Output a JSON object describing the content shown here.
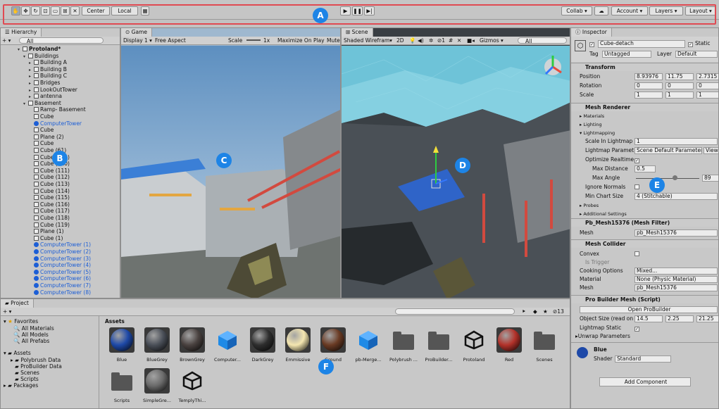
{
  "toolbar": {
    "center": "Center",
    "local": "Local",
    "collab": "Collab ▾",
    "account": "Account ▾",
    "layers": "Layers ▾",
    "layout": "Layout ▾"
  },
  "badges": [
    "A",
    "B",
    "C",
    "D",
    "E",
    "F"
  ],
  "hierarchy": {
    "tab": "Hierarchy",
    "create": "+ ▾",
    "search": "All",
    "items": [
      {
        "t": "Protoland*",
        "k": "scene"
      },
      {
        "t": "Buildings",
        "k": "open"
      },
      {
        "t": "Building A",
        "k": "closed"
      },
      {
        "t": "Building B",
        "k": "closed"
      },
      {
        "t": "Building C",
        "k": "closed"
      },
      {
        "t": "Bridges",
        "k": "closed"
      },
      {
        "t": "LookOutTower",
        "k": "closed"
      },
      {
        "t": "antenna",
        "k": "closed"
      },
      {
        "t": "Basement",
        "k": "open"
      },
      {
        "t": "Ramp- Basement",
        "k": "leaf"
      },
      {
        "t": "Cube",
        "k": "leaf"
      },
      {
        "t": "ComputerTower",
        "k": "prefab"
      },
      {
        "t": "Cube",
        "k": "leaf"
      },
      {
        "t": "Plane (2)",
        "k": "leaf"
      },
      {
        "t": "Cube",
        "k": "leaf"
      },
      {
        "t": "Cube (61)",
        "k": "leaf"
      },
      {
        "t": "Cube (109)",
        "k": "leaf"
      },
      {
        "t": "Cube (110)",
        "k": "leaf"
      },
      {
        "t": "Cube (111)",
        "k": "leaf"
      },
      {
        "t": "Cube (112)",
        "k": "leaf"
      },
      {
        "t": "Cube (113)",
        "k": "leaf"
      },
      {
        "t": "Cube (114)",
        "k": "leaf"
      },
      {
        "t": "Cube (115)",
        "k": "leaf"
      },
      {
        "t": "Cube (116)",
        "k": "leaf"
      },
      {
        "t": "Cube (117)",
        "k": "leaf"
      },
      {
        "t": "Cube (118)",
        "k": "leaf"
      },
      {
        "t": "Cube (119)",
        "k": "leaf"
      },
      {
        "t": "Plane (1)",
        "k": "leaf"
      },
      {
        "t": "Cube (1)",
        "k": "leaf"
      },
      {
        "t": "ComputerTower (1)",
        "k": "prefab"
      },
      {
        "t": "ComputerTower (2)",
        "k": "prefab"
      },
      {
        "t": "ComputerTower (3)",
        "k": "prefab"
      },
      {
        "t": "ComputerTower (4)",
        "k": "prefab"
      },
      {
        "t": "ComputerTower (5)",
        "k": "prefab"
      },
      {
        "t": "ComputerTower (6)",
        "k": "prefab"
      },
      {
        "t": "ComputerTower (7)",
        "k": "prefab"
      },
      {
        "t": "ComputerTower (8)",
        "k": "prefab"
      }
    ]
  },
  "game": {
    "tab": "Game",
    "display": "Display 1 ▾",
    "aspect": "Free Aspect",
    "scale_label": "Scale",
    "scale_val": "1x",
    "maximize": "Maximize On Play",
    "mute": "Mute"
  },
  "scene": {
    "tab": "Scene",
    "shading": "Shaded Wirefram▾",
    "mode2d": "2D",
    "gizmos": "Gizmos ▾",
    "search": "All"
  },
  "inspector": {
    "tab": "Inspector",
    "name": "Cube-detach",
    "static": "Static",
    "tag_label": "Tag",
    "tag": "Untagged",
    "layer_label": "Layer",
    "layer": "Default",
    "transform": "Transform",
    "position": "Position",
    "pos": [
      "8.93976",
      "11.75",
      "2.7315"
    ],
    "rotation": "Rotation",
    "rot": [
      "0",
      "0",
      "0"
    ],
    "scale": "Scale",
    "scl": [
      "1",
      "1",
      "1"
    ],
    "mesh_renderer": "Mesh Renderer",
    "materials": "Materials",
    "lighting": "Lighting",
    "lightmapping": "Lightmapping",
    "scale_lm": "Scale In Lightmap",
    "scale_lm_v": "1",
    "lm_params": "Lightmap Paramet",
    "lm_params_v": "Scene Default Parameter ▾",
    "view": "View",
    "opt_realtime": "Optimize Realtime",
    "max_dist": "Max Distance",
    "max_dist_v": "0.5",
    "max_angle": "Max Angle",
    "max_angle_v": "89",
    "ignore_normals": "Ignore Normals",
    "min_chart": "Min Chart Size",
    "min_chart_v": "4 (Stitchable)",
    "probes": "Probes",
    "additional": "Additional Settings",
    "mesh_filter": "Pb_Mesh15376 (Mesh Filter)",
    "mesh": "Mesh",
    "mesh_v": "pb_Mesh15376",
    "mesh_collider": "Mesh Collider",
    "convex": "Convex",
    "is_trigger": "Is Trigger",
    "cooking": "Cooking Options",
    "cooking_v": "Mixed...",
    "material": "Material",
    "material_v": "None (Physic Material)",
    "mesh2_v": "pb_Mesh15376",
    "pbmesh": "Pro Builder Mesh (Script)",
    "open_pb": "Open ProBuilder",
    "obj_size": "Object Size (read on",
    "size": [
      "14.5",
      "2.25",
      "21.25"
    ],
    "lm_static": "Lightmap Static",
    "unwrap": "Unwrap Parameters",
    "mat_name": "Blue",
    "shader_label": "Shader",
    "shader": "Standard",
    "add_component": "Add Component"
  },
  "project": {
    "tab": "Project",
    "create": "+ ▾",
    "count": "13",
    "assets_header": "Assets",
    "favorites": "Favorites",
    "fav_items": [
      "All Materials",
      "All Models",
      "All Prefabs"
    ],
    "assets_root": "Assets",
    "asset_folders": [
      "Polybrush Data",
      "ProBuilder Data",
      "Scenes",
      "Scripts"
    ],
    "packages": "Packages",
    "assets": [
      {
        "n": "Blue",
        "k": "sphere",
        "c": "#1e49a8"
      },
      {
        "n": "BlueGrey",
        "k": "sphere",
        "c": "#4a4f58"
      },
      {
        "n": "BrownGrey",
        "k": "sphere",
        "c": "#4a4240"
      },
      {
        "n": "Computer...",
        "k": "cube",
        "c": "#1f8ae6"
      },
      {
        "n": "DarkGrey",
        "k": "sphere",
        "c": "#2e2e2e"
      },
      {
        "n": "Emmissive",
        "k": "sphere",
        "c": "#f4e6b0"
      },
      {
        "n": "Ground",
        "k": "sphere",
        "c": "#6a3b24"
      },
      {
        "n": "pb-Merge...",
        "k": "cube",
        "c": "#1f8ae6"
      },
      {
        "n": "Polybrush ...",
        "k": "folder",
        "c": "#555"
      },
      {
        "n": "ProBuilder...",
        "k": "folder",
        "c": "#555"
      },
      {
        "n": "Protoland",
        "k": "unity",
        "c": "#111"
      },
      {
        "n": "Red",
        "k": "sphere",
        "c": "#b3322a"
      },
      {
        "n": "Scenes",
        "k": "folder",
        "c": "#555"
      },
      {
        "n": "Scripts",
        "k": "folder",
        "c": "#555"
      },
      {
        "n": "SimpleGre...",
        "k": "sphere",
        "c": "#6a6a6a"
      },
      {
        "n": "TemplyThi...",
        "k": "unity",
        "c": "#111"
      }
    ]
  }
}
